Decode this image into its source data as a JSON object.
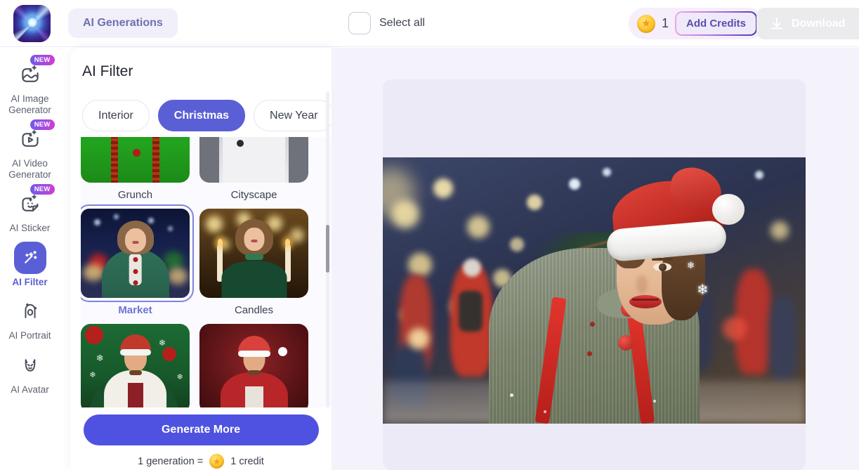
{
  "app": {
    "logo_icon": "star-burst-logo",
    "brand_accent": "#5b5fd6"
  },
  "topbar": {
    "generations_label": "AI Generations",
    "select_all_label": "Select all",
    "select_all_checked": false,
    "credits_icon": "coin-icon",
    "credits_count": "1",
    "add_credits_label": "Add Credits",
    "download_label": "Download",
    "download_icon": "download-icon",
    "download_disabled": true
  },
  "sidebar": {
    "items": [
      {
        "label": "AI Image\nGenerator",
        "label_line1": "AI Image",
        "label_line2": "Generator",
        "icon": "image-sparkle-icon",
        "badge": "NEW",
        "active": false
      },
      {
        "label": "AI Video Generator",
        "label_line1": "AI Video",
        "label_line2": "Generator",
        "icon": "video-play-sparkle-icon",
        "badge": "NEW",
        "active": false
      },
      {
        "label": "AI Sticker",
        "label_line1": "AI Sticker",
        "label_line2": "",
        "icon": "sticker-face-icon",
        "badge": "NEW",
        "active": false
      },
      {
        "label": "AI Filter",
        "label_line1": "AI Filter",
        "label_line2": "",
        "icon": "magic-wand-icon",
        "badge": "",
        "active": true
      },
      {
        "label": "AI Portrait",
        "label_line1": "AI Portrait",
        "label_line2": "",
        "icon": "portrait-frame-icon",
        "badge": "",
        "active": false
      },
      {
        "label": "AI Avatar",
        "label_line1": "AI Avatar",
        "label_line2": "",
        "icon": "cat-avatar-icon",
        "badge": "",
        "active": false
      }
    ]
  },
  "filter_panel": {
    "title": "AI Filter",
    "tabs": [
      {
        "label": "Interior",
        "active": false
      },
      {
        "label": "Christmas",
        "active": true
      },
      {
        "label": "New Year",
        "active": false
      }
    ],
    "styles": [
      {
        "label": "Grunch",
        "selected": false
      },
      {
        "label": "Cityscape",
        "selected": false
      },
      {
        "label": "Market",
        "selected": true
      },
      {
        "label": "Candles",
        "selected": false
      },
      {
        "label": "",
        "selected": false
      },
      {
        "label": "",
        "selected": false
      }
    ],
    "generate_label": "Generate More",
    "credit_note_prefix": "1 generation =",
    "credit_note_suffix": "1 credit",
    "credit_note_icon": "coin-icon"
  },
  "preview": {
    "image_alt": "woman in santa hat at christmas market",
    "card_background": "#eceaf7"
  }
}
